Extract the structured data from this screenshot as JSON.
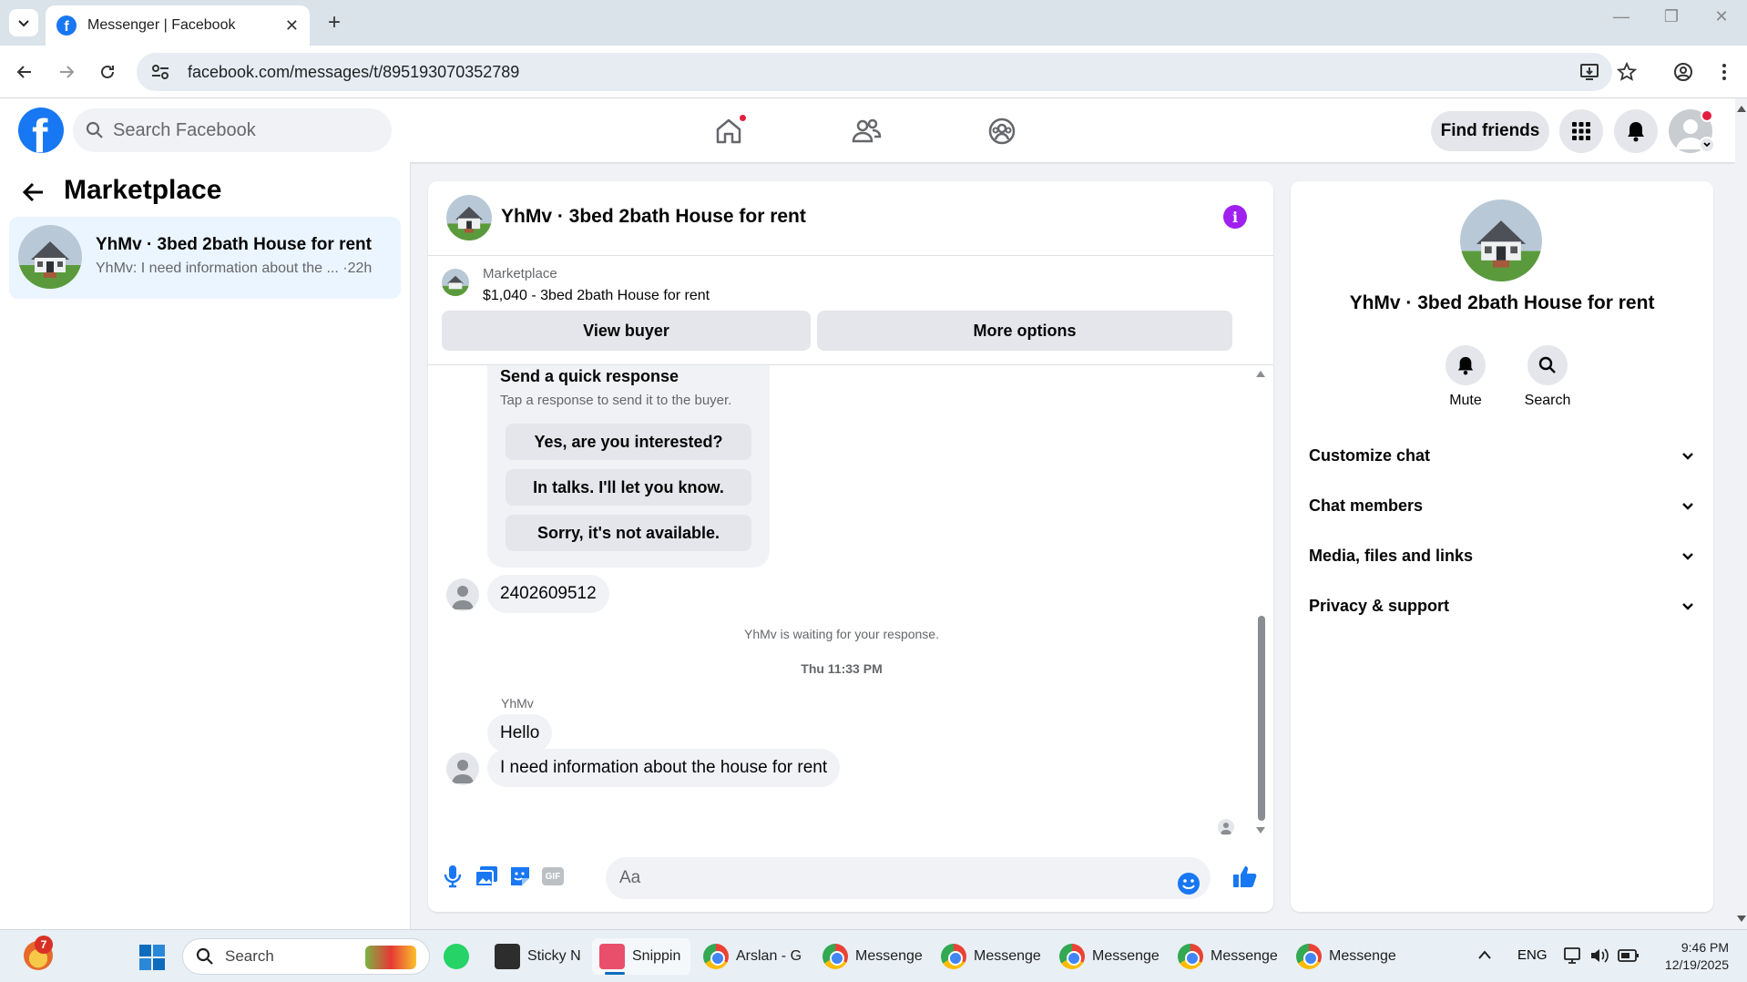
{
  "browser": {
    "tab_title": "Messenger | Facebook",
    "url": "facebook.com/messages/t/895193070352789",
    "favicon_letter": "f"
  },
  "fb": {
    "search_placeholder": "Search Facebook",
    "find_friends_label": "Find friends",
    "logo_letter": "f"
  },
  "left": {
    "title": "Marketplace",
    "thread": {
      "name": "YhMv · 3bed 2bath House for rent",
      "snippet": "YhMv: I need information about the ... ·22h"
    }
  },
  "chat": {
    "title": "YhMv · 3bed 2bath House for rent",
    "listing": {
      "label": "Marketplace",
      "price_title": "$1,040 - 3bed 2bath House for rent",
      "view_buyer_label": "View buyer",
      "more_options_label": "More options"
    },
    "quick_response": {
      "heading": "Send a quick response",
      "subtext": "Tap a response to send it to the buyer.",
      "options": [
        "Yes, are you interested?",
        "In talks. I'll let you know.",
        "Sorry, it's not available."
      ]
    },
    "messages": {
      "phone": "2402609512",
      "waiting_note": "YhMv is waiting for your response.",
      "timestamp": "Thu 11:33 PM",
      "sender": "YhMv",
      "hello": "Hello",
      "info_request": "I need information about the house for rent"
    },
    "composer_placeholder": "Aa",
    "gif_label": "GIF"
  },
  "right": {
    "name": "YhMv · 3bed 2bath House for rent",
    "actions": {
      "mute": "Mute",
      "search": "Search"
    },
    "sections": [
      "Customize chat",
      "Chat members",
      "Media, files and links",
      "Privacy & support"
    ]
  },
  "taskbar": {
    "search_placeholder": "Search",
    "badge_count": "7",
    "items": [
      "Sticky N",
      "Snippin",
      "Arslan - G",
      "Messenge",
      "Messenge",
      "Messenge",
      "Messenge",
      "Messenge"
    ],
    "language": "ENG",
    "time": "9:46 PM",
    "date": "12/19/2025"
  },
  "colors": {
    "facebook_blue": "#1877f2",
    "info_purple": "#a020f0",
    "notification_red": "#e41e3f",
    "selected_thread_bg": "#ebf5ff"
  }
}
